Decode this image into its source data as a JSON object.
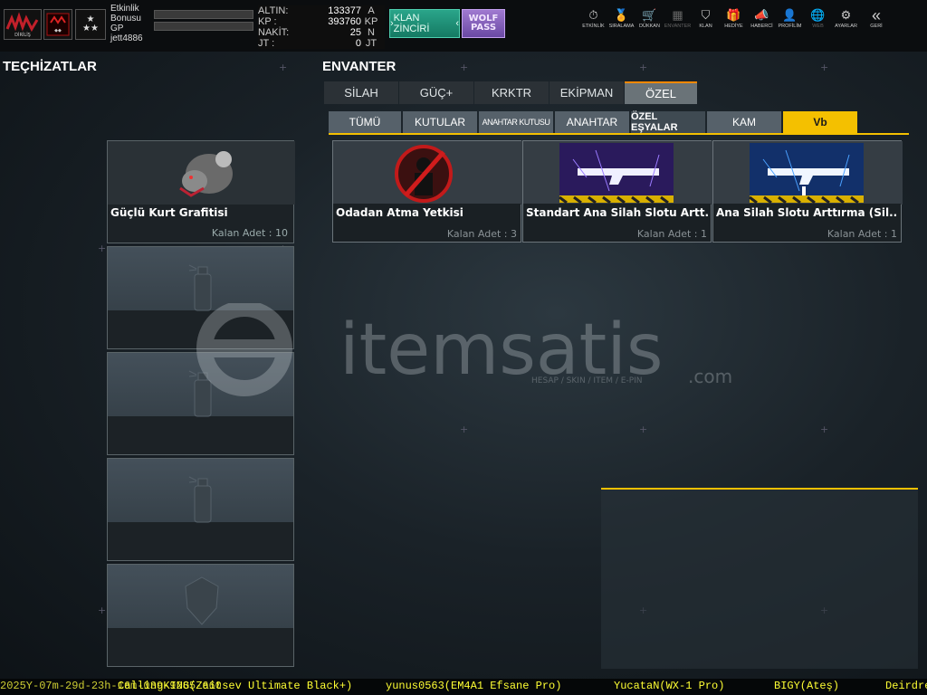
{
  "player": {
    "labels": {
      "event_bonus": "Etkinlik\nBonusu",
      "gp": "GP"
    },
    "username": "jett4886"
  },
  "currency": [
    {
      "label": "ALTIN:",
      "value": "133377",
      "unit": "A"
    },
    {
      "label": "KP  :",
      "value": "393760",
      "unit": "KP"
    },
    {
      "label": "NAKİT:",
      "value": "25",
      "unit": "N"
    },
    {
      "label": "JT   :",
      "value": "0",
      "unit": "JT"
    }
  ],
  "buttons": {
    "klan_chain": "KLAN ZİNCİRİ",
    "wolf_pass": "WOLF PASS"
  },
  "nav": [
    {
      "label": "ETKİNLİK",
      "icon": "clock-icon"
    },
    {
      "label": "SIRALAMA",
      "icon": "medal-icon"
    },
    {
      "label": "DÜKKAN",
      "icon": "cart-icon"
    },
    {
      "label": "ENVANTER",
      "icon": "inventory-icon"
    },
    {
      "label": "KLAN",
      "icon": "shield-icon"
    },
    {
      "label": "HEDİYE",
      "icon": "gift-icon"
    },
    {
      "label": "HABERCİ",
      "icon": "megaphone-icon"
    },
    {
      "label": "PROFİLİM",
      "icon": "profile-icon"
    },
    {
      "label": "WEB",
      "icon": "globe-icon"
    },
    {
      "label": "AYARLAR",
      "icon": "gear-icon"
    },
    {
      "label": "GERİ",
      "icon": "back-icon"
    }
  ],
  "left": {
    "title": "TEÇHİZATLAR",
    "slots": [
      {
        "name": "Güçlü Kurt Grafitisi",
        "count": "Kalan Adet : 10"
      }
    ]
  },
  "inventory": {
    "title": "ENVANTER",
    "tabs": [
      "SİLAH",
      "GÜÇ+",
      "KRKTR",
      "EKİPMAN",
      "ÖZEL"
    ],
    "active_tab": "ÖZEL",
    "subtabs": [
      "TÜMÜ",
      "KUTULAR",
      "ANAHTAR KUTUSU",
      "ANAHTAR",
      "ÖZEL EŞYALAR",
      "KAM",
      "Vb"
    ],
    "active_subtab": "Vb",
    "items": [
      {
        "name": "Odadan Atma Yetkisi",
        "count": "Kalan Adet : 3"
      },
      {
        "name": "Standart Ana Silah Slotu Artt...",
        "count": "Kalan Adet : 1"
      },
      {
        "name": "Ana Silah Slotu Arttırma (Sil...",
        "count": "Kalan Adet : 1"
      }
    ]
  },
  "watermark": {
    "brand": "itemsatis",
    "domain": ".com",
    "tagline": "HESAP / SKIN / ITEM / E-PIN"
  },
  "chat_ticker": [
    "2025Y-07m-29d-23h-16m-039-9285-660",
    "CallingKING(Zaitsev Ultimate Black+)",
    "yunus0563(EM4A1 Efsane Pro)",
    "YucataN(WX-1 Pro)",
    "BIGY(Ateş)",
    "Deirdre"
  ],
  "colors": {
    "accent_yellow": "#f4c000",
    "tab_orange": "#ff8800",
    "ticker": "#ffff33"
  }
}
